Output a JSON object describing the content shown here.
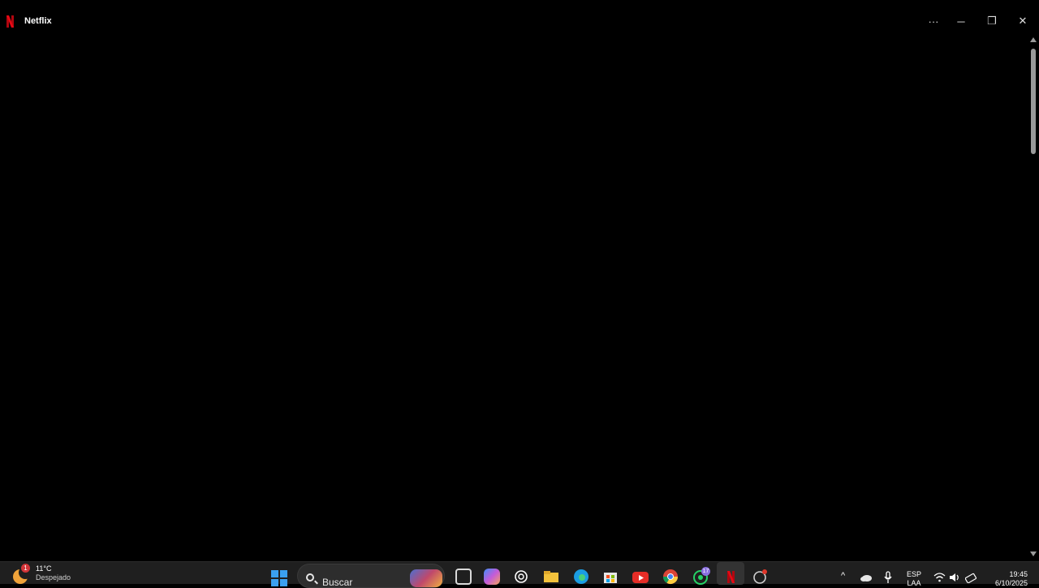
{
  "window": {
    "title": "Netflix",
    "more_label": "···",
    "minimize_label": "─",
    "maximize_label": "❐",
    "close_label": "✕"
  },
  "taskbar": {
    "weather": {
      "temp": "11°C",
      "condition": "Despejado",
      "badge": "1"
    },
    "search": {
      "placeholder": "Buscar"
    },
    "apps": [
      {
        "name": "task-view",
        "color": "#d9d9d9"
      },
      {
        "name": "copilot",
        "color": "#6b7cf0"
      },
      {
        "name": "chatgpt",
        "color": "#ffffff"
      },
      {
        "name": "file-explorer",
        "color": "#f3c23c"
      },
      {
        "name": "edge",
        "color": "#2fa8d8"
      },
      {
        "name": "microsoft-store",
        "color": "#4da3f0"
      },
      {
        "name": "youtube",
        "color": "#e52d27"
      },
      {
        "name": "chrome",
        "color": "#4caf50"
      },
      {
        "name": "whatsapp",
        "color": "#25d366"
      },
      {
        "name": "netflix",
        "color": "#e50914"
      },
      {
        "name": "other-app",
        "color": "#bbbbbb"
      }
    ],
    "whatsapp_badge": "17",
    "tray": {
      "chevron": "^",
      "language": "ESP",
      "language_sub": "LAA",
      "time": "19:45",
      "date": "6/10/2025"
    }
  }
}
